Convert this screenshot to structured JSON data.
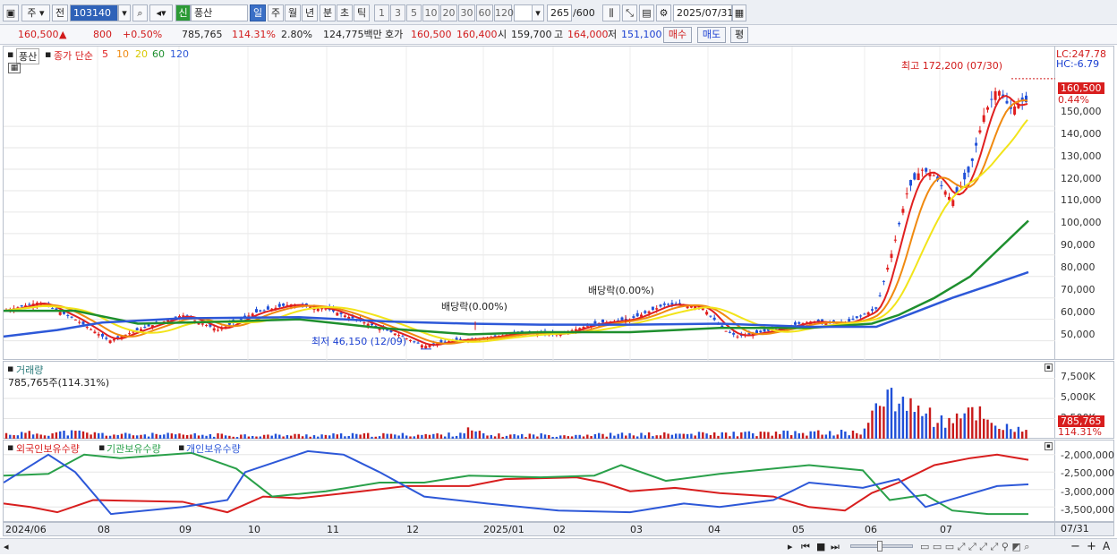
{
  "toolbar": {
    "market": "주",
    "prev": "전",
    "code": "103140",
    "name": "풍산",
    "new_badge": "신",
    "periods": [
      "일",
      "주",
      "월",
      "년",
      "분",
      "초",
      "틱"
    ],
    "minutes": [
      "1",
      "3",
      "5",
      "10",
      "20",
      "30",
      "60",
      "120"
    ],
    "count": "265",
    "count_max": "/600",
    "date": "2025/07/31"
  },
  "quote": {
    "price": "160,500",
    "change": "800",
    "change_pct": "+0.50%",
    "volume": "785,765",
    "vol_ratio": "114.31%",
    "turnover": "2.80%",
    "amount": "124,775백만",
    "hoga_label": "호가",
    "ask": "160,500",
    "bid": "160,400",
    "open_label": "시",
    "open": "159,700",
    "high_label": "고",
    "high": "164,000",
    "low_label": "저",
    "low": "151,100",
    "buy": "매수",
    "sell": "매도",
    "eval": "평"
  },
  "price_panel": {
    "name": "풍산",
    "legend_prefix": "종가 단순",
    "ma_periods": [
      "5",
      "10",
      "20",
      "60",
      "120"
    ],
    "ma_colors": [
      "#e02020",
      "#f08a10",
      "#f2e41a",
      "#1e8f2e",
      "#2d58d8"
    ],
    "lc": "LC:247.78",
    "hc": "HC:-6.79",
    "high_annot": "최고 172,200 (07/30)",
    "low_annot": "최저 46,150 (12/09)",
    "dividend1": "배당락(0.00%)",
    "dividend2": "배당락(0.00%)",
    "current_tag": "160,500",
    "current_pct": "0.44%",
    "y_ticks": [
      "150,000",
      "140,000",
      "130,000",
      "120,000",
      "110,000",
      "100,000",
      "90,000",
      "80,000",
      "70,000",
      "60,000",
      "50,000"
    ]
  },
  "volume_panel": {
    "title": "거래량",
    "value": "785,765주(114.31%)",
    "y_ticks": [
      "7,500K",
      "5,000K",
      "2,500K"
    ],
    "current_tag": "785,765",
    "current_pct": "114.31%"
  },
  "holding_panel": {
    "series": [
      "외국인보유수량",
      "기관보유수량",
      "개인보유수량"
    ],
    "colors": [
      "#d81e1e",
      "#2aa04a",
      "#2d58d8"
    ],
    "y_ticks": [
      "-2,000,000",
      "-2,500,000",
      "-3,000,000",
      "-3,500,000"
    ]
  },
  "date_axis": [
    "2024/06",
    "08",
    "09",
    "10",
    "11",
    "12",
    "2025/01",
    "02",
    "03",
    "04",
    "05",
    "06",
    "07"
  ],
  "date_axis_end": "07/31",
  "chart_data": [
    {
      "type": "line",
      "title": "풍산",
      "x": [
        "2024/06",
        "2024/08",
        "2024/09",
        "2024/10",
        "2024/11",
        "2024/12",
        "2025/01",
        "2025/02",
        "2025/03",
        "2025/04",
        "2025/05",
        "2025/06",
        "2025/07",
        "2025/07/31"
      ],
      "series": [
        {
          "name": "5",
          "values": [
            63000,
            52000,
            64000,
            62000,
            67000,
            50000,
            52000,
            56000,
            64000,
            53000,
            60000,
            95000,
            128000,
            160500
          ]
        },
        {
          "name": "120",
          "values": [
            52000,
            58000,
            60000,
            61000,
            60000,
            57000,
            58000,
            57000,
            58000,
            57500,
            56500,
            58000,
            78000,
            82000
          ]
        }
      ],
      "ylim": [
        44000,
        178000
      ]
    },
    {
      "type": "bar",
      "title": "거래량",
      "values_note_units": "K",
      "series": [
        {
          "name": "거래량",
          "values": [
            900,
            700,
            800,
            600,
            1000,
            800,
            700,
            600,
            1200,
            900,
            800,
            7900,
            4500,
            786
          ]
        }
      ]
    }
  ]
}
